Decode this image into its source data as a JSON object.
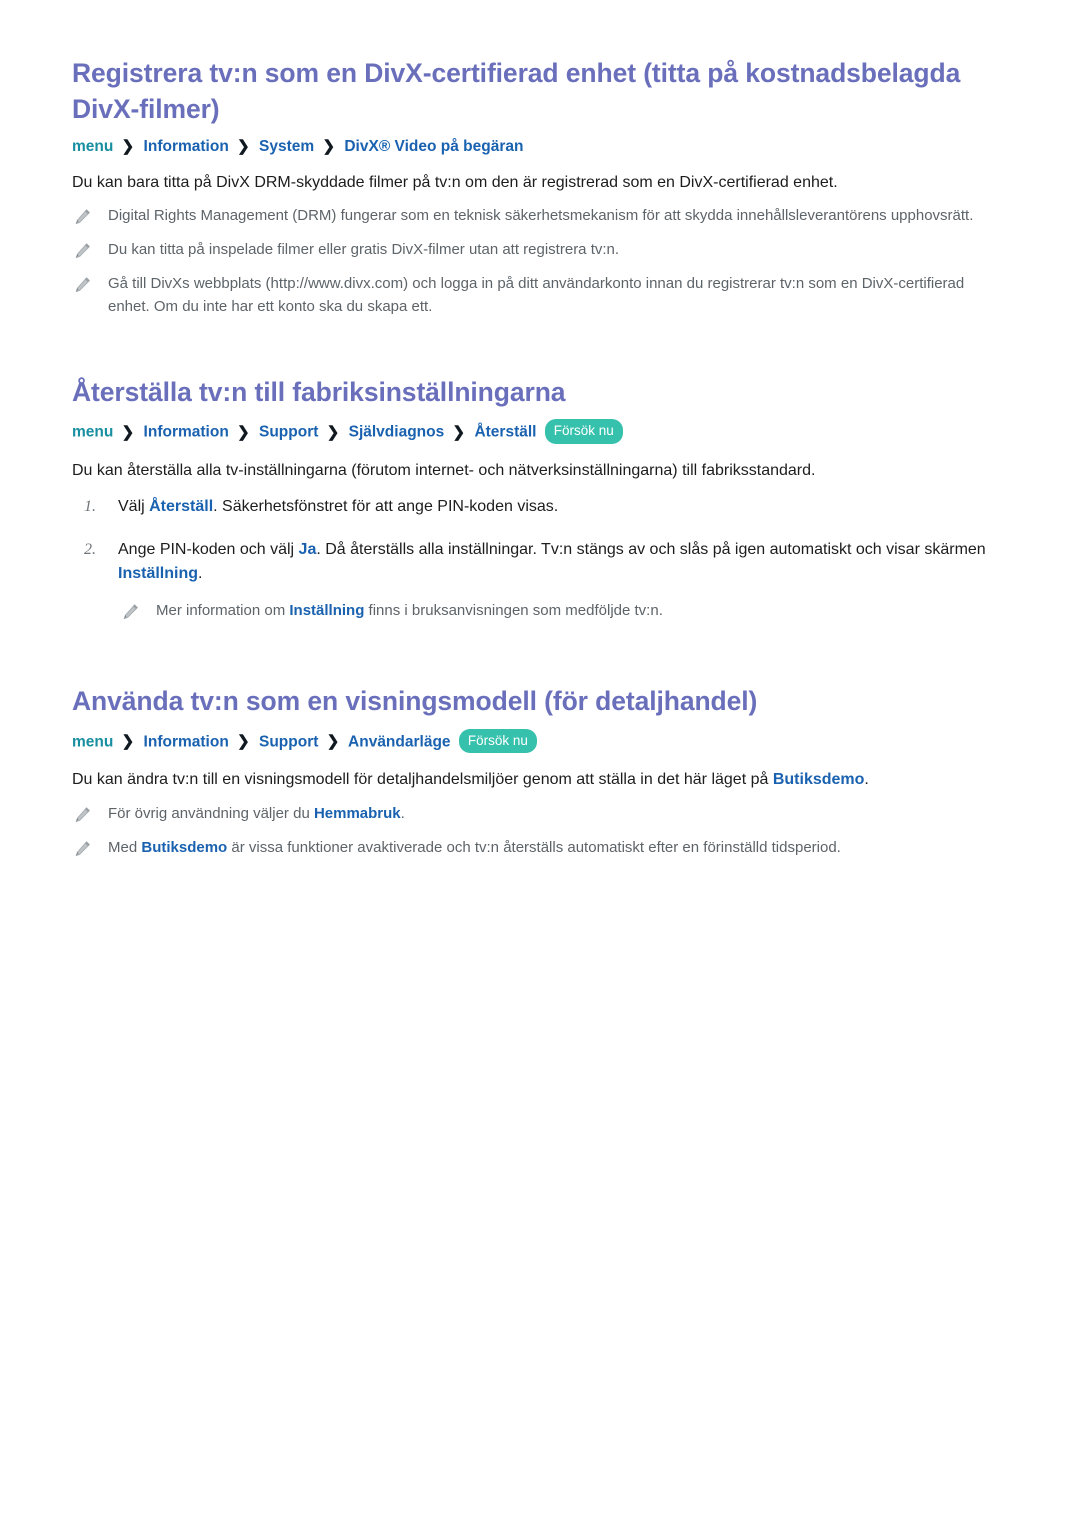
{
  "document": {
    "language": "sv",
    "colors": {
      "heading": "#6a6fbb",
      "breadcrumb_menu": "#188fa0",
      "breadcrumb_item": "#1a62b0",
      "badge_background": "#36c1ad",
      "badge_text": "#ffffff",
      "inline_term": "#1a62b0",
      "body_text": "#1d1d1d",
      "note_text": "#5d6469",
      "page_background": "#ffffff"
    },
    "icons": {
      "pencil": "pencil-icon",
      "breadcrumb_separator": "chevron-right-icon"
    }
  },
  "sections": [
    {
      "id": "divx",
      "heading": "Registrera tv:n som en DivX-certifierad enhet (titta på kostnadsbelagda DivX-filmer)",
      "breadcrumb": {
        "root": "menu",
        "separator": "❯",
        "items": [
          "Information",
          "System",
          "DivX® Video på begäran"
        ],
        "badge": null
      },
      "lead": "Du kan bara titta på DivX DRM-skyddade filmer på tv:n om den är registrerad som en DivX-certifierad enhet.",
      "notes": [
        {
          "segments": [
            {
              "text": "Digital Rights Management (DRM) fungerar som en teknisk säkerhetsmekanism för att skydda innehållsleverantörens upphovsrätt.",
              "style": "plain"
            }
          ]
        },
        {
          "segments": [
            {
              "text": "Du kan titta på inspelade filmer eller gratis DivX-filmer utan att registrera tv:n.",
              "style": "plain"
            }
          ]
        },
        {
          "segments": [
            {
              "text": "Gå till DivXs webbplats (http://www.divx.com) och logga in på ditt användarkonto innan du registrerar tv:n som en DivX-certifierad enhet. Om du inte har ett konto ska du skapa ett.",
              "style": "plain"
            }
          ]
        }
      ]
    },
    {
      "id": "factory-reset",
      "heading": "Återställa tv:n till fabriksinställningarna",
      "breadcrumb": {
        "root": "menu",
        "separator": "❯",
        "items": [
          "Information",
          "Support",
          "Självdiagnos",
          "Återställ"
        ],
        "badge": "Försök nu"
      },
      "lead": "Du kan återställa alla tv-inställningarna (förutom internet- och nätverksinställningarna) till fabriksstandard.",
      "steps": [
        {
          "number": "1.",
          "segments": [
            {
              "text": "Välj ",
              "style": "plain"
            },
            {
              "text": "Återställ",
              "style": "term"
            },
            {
              "text": ". Säkerhetsfönstret för att ange PIN-koden visas.",
              "style": "plain"
            }
          ]
        },
        {
          "number": "2.",
          "segments": [
            {
              "text": "Ange PIN-koden och välj ",
              "style": "plain"
            },
            {
              "text": "Ja",
              "style": "term"
            },
            {
              "text": ". Då återställs alla inställningar. Tv:n stängs av och slås på igen automatiskt och visar skärmen ",
              "style": "plain"
            },
            {
              "text": "Inställning",
              "style": "term"
            },
            {
              "text": ".",
              "style": "plain"
            }
          ]
        }
      ],
      "sub_note": {
        "segments": [
          {
            "text": "Mer information om ",
            "style": "plain"
          },
          {
            "text": "Inställning",
            "style": "term"
          },
          {
            "text": " finns i bruksanvisningen som medföljde tv:n.",
            "style": "plain"
          }
        ]
      }
    },
    {
      "id": "retail-mode",
      "heading": "Använda tv:n som en visningsmodell (för detaljhandel)",
      "breadcrumb": {
        "root": "menu",
        "separator": "❯",
        "items": [
          "Information",
          "Support",
          "Användarläge"
        ],
        "badge": "Försök nu"
      },
      "lead_segments": [
        {
          "text": "Du kan ändra tv:n till en visningsmodell för detaljhandelsmiljöer genom att ställa in det här läget på ",
          "style": "plain"
        },
        {
          "text": "Butiksdemo",
          "style": "term"
        },
        {
          "text": ".",
          "style": "plain"
        }
      ],
      "notes": [
        {
          "segments": [
            {
              "text": "För övrig användning väljer du ",
              "style": "plain"
            },
            {
              "text": "Hemmabruk",
              "style": "term"
            },
            {
              "text": ".",
              "style": "plain"
            }
          ]
        },
        {
          "segments": [
            {
              "text": "Med ",
              "style": "plain"
            },
            {
              "text": "Butiksdemo",
              "style": "term"
            },
            {
              "text": " är vissa funktioner avaktiverade och tv:n återställs automatiskt efter en förinställd tidsperiod.",
              "style": "plain"
            }
          ]
        }
      ]
    }
  ]
}
